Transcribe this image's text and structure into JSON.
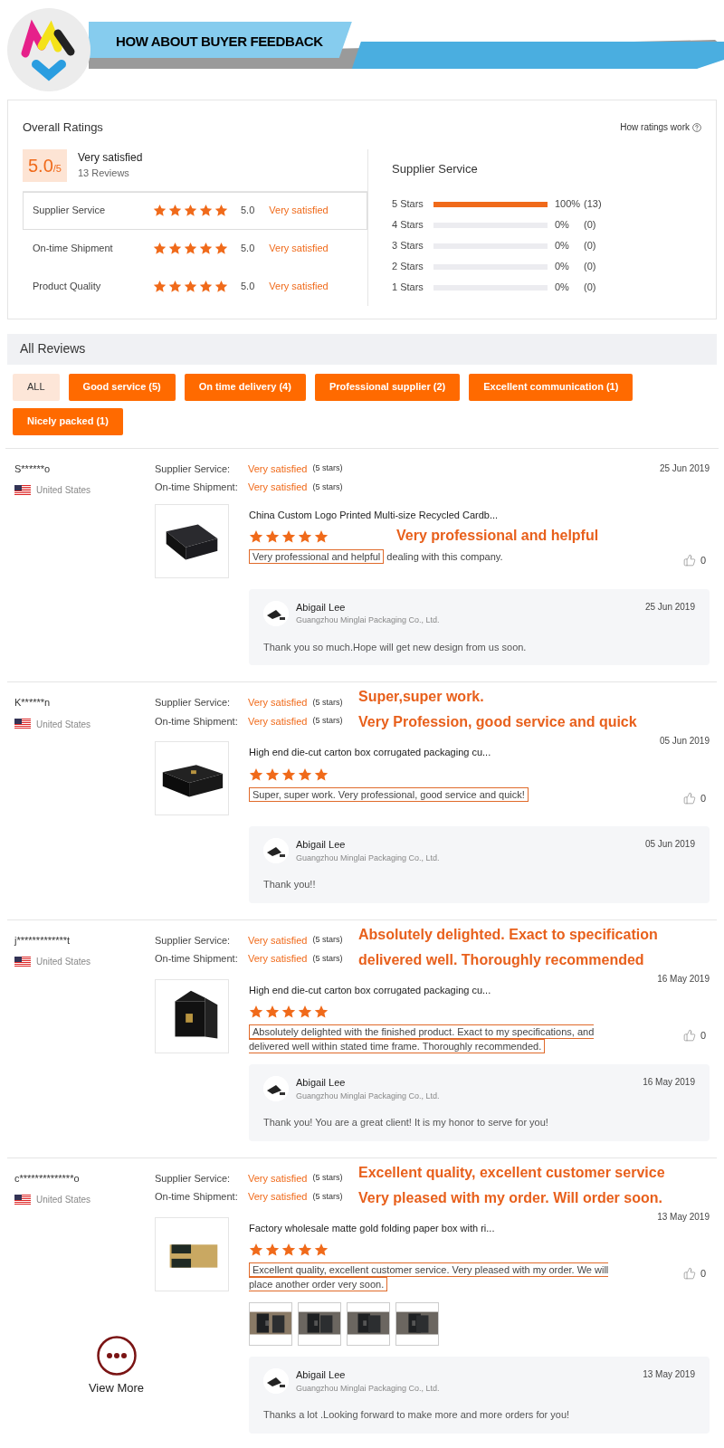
{
  "header": {
    "title": "HOW ABOUT BUYER FEEDBACK"
  },
  "overall": {
    "title": "Overall Ratings",
    "help_link": "How ratings work",
    "score": "5.0",
    "score_max": "/5",
    "verdict": "Very satisfied",
    "review_count": "13 Reviews",
    "rows": [
      {
        "label": "Supplier Service",
        "stars": 5,
        "score": "5.0",
        "verdict": "Very satisfied",
        "selected": true
      },
      {
        "label": "On-time Shipment",
        "stars": 5,
        "score": "5.0",
        "verdict": "Very satisfied",
        "selected": false
      },
      {
        "label": "Product Quality",
        "stars": 5,
        "score": "5.0",
        "verdict": "Very satisfied",
        "selected": false
      }
    ],
    "histogram": {
      "title": "Supplier Service",
      "rows": [
        {
          "label": "5 Stars",
          "level": 1,
          "percent": "100%",
          "count": "(13)"
        },
        {
          "label": "4 Stars",
          "level": 0,
          "percent": "0%",
          "count": "(0)"
        },
        {
          "label": "3 Stars",
          "level": 0,
          "percent": "0%",
          "count": "(0)"
        },
        {
          "label": "2 Stars",
          "level": 0,
          "percent": "0%",
          "count": "(0)"
        },
        {
          "label": "1 Stars",
          "level": 0,
          "percent": "0%",
          "count": "(0)"
        }
      ]
    }
  },
  "all_reviews": {
    "title": "All Reviews",
    "filters": [
      {
        "label": "ALL",
        "selected": true
      },
      {
        "label": "Good service (5)",
        "selected": false
      },
      {
        "label": "On time delivery (4)",
        "selected": false
      },
      {
        "label": "Professional supplier (2)",
        "selected": false
      },
      {
        "label": "Excellent communication (1)",
        "selected": false
      },
      {
        "label": "Nicely packed (1)",
        "selected": false
      }
    ]
  },
  "reviews": [
    {
      "reviewer": "S******o",
      "country": "United States",
      "date": "25 Jun 2019",
      "ratings": [
        {
          "label": "Supplier Service:",
          "value": "Very satisfied",
          "note": "(5 stars)"
        },
        {
          "label": "On-time Shipment:",
          "value": "Very satisfied",
          "note": "(5 stars)"
        }
      ],
      "product": "China Custom Logo Printed Multi-size Recycled Cardb...",
      "stars": 5,
      "comment_highlight": "Very professional and helpful",
      "comment_rest": "dealing with this company.",
      "likes": "0",
      "annotation": {
        "kind": "stars",
        "lines": [
          "Very professional and helpful"
        ]
      },
      "reply": {
        "name": "Abigail Lee",
        "company": "Guangzhou Minglai Packaging Co., Ltd.",
        "date": "25 Jun 2019",
        "text": "Thank you so much.Hope will get new design from us soon."
      }
    },
    {
      "reviewer": "K******n",
      "country": "United States",
      "date": "05 Jun 2019",
      "ratings": [
        {
          "label": "Supplier Service:",
          "value": "Very satisfied",
          "note": "(5 stars)"
        },
        {
          "label": "On-time Shipment:",
          "value": "Very satisfied",
          "note": "(5 stars)"
        }
      ],
      "product": "High end die-cut carton box corrugated packaging cu...",
      "stars": 5,
      "comment_highlight": "Super, super work. Very professional, good service and quick!",
      "likes": "0",
      "annotation": {
        "kind": "top",
        "lines": [
          "Super,super work.",
          "Very Profession, good service and quick"
        ]
      },
      "reply": {
        "name": "Abigail Lee",
        "company": "Guangzhou Minglai Packaging Co., Ltd.",
        "date": "05 Jun 2019",
        "text": "Thank you!!"
      }
    },
    {
      "reviewer": "j*************t",
      "country": "United States",
      "date": "16 May 2019",
      "ratings": [
        {
          "label": "Supplier Service:",
          "value": "Very satisfied",
          "note": "(5 stars)"
        },
        {
          "label": "On-time Shipment:",
          "value": "Very satisfied",
          "note": "(5 stars)"
        }
      ],
      "product": "High end die-cut carton box corrugated packaging cu...",
      "stars": 5,
      "comment_highlight": "Absolutely delighted with the finished product. Exact to my specifications, and delivered well within stated time frame. Thoroughly recommended.",
      "likes": "0",
      "annotation": {
        "kind": "top",
        "lines": [
          "Absolutely delighted. Exact to specification",
          "delivered well. Thoroughly recommended"
        ]
      },
      "reply": {
        "name": "Abigail Lee",
        "company": "Guangzhou Minglai Packaging Co., Ltd.",
        "date": "16 May 2019",
        "text": "Thank you! You are a great client! It is my honor to serve for you!"
      }
    },
    {
      "reviewer": "c**************o",
      "country": "United States",
      "date": "13 May 2019",
      "ratings": [
        {
          "label": "Supplier Service:",
          "value": "Very satisfied",
          "note": "(5 stars)"
        },
        {
          "label": "On-time Shipment:",
          "value": "Very satisfied",
          "note": "(5 stars)"
        }
      ],
      "product": "Factory wholesale matte gold folding paper box with ri...",
      "stars": 5,
      "comment_highlight": "Excellent quality, excellent customer service. Very pleased with my order. We will place another order very soon.",
      "likes": "0",
      "photos": [
        {
          "kind": "picture"
        },
        {
          "kind": "picture"
        },
        {
          "kind": "picture"
        },
        {
          "kind": "picture"
        }
      ],
      "annotation": {
        "kind": "top",
        "lines": [
          "Excellent quality, excellent customer service",
          "Very pleased with my order. Will order soon."
        ]
      },
      "reply": {
        "name": "Abigail Lee",
        "company": "Guangzhou Minglai Packaging Co., Ltd.",
        "date": "13 May 2019",
        "text": "Thanks a lot .Looking forward to make more and more orders for you!"
      }
    }
  ],
  "view_more": {
    "label": "View More"
  }
}
